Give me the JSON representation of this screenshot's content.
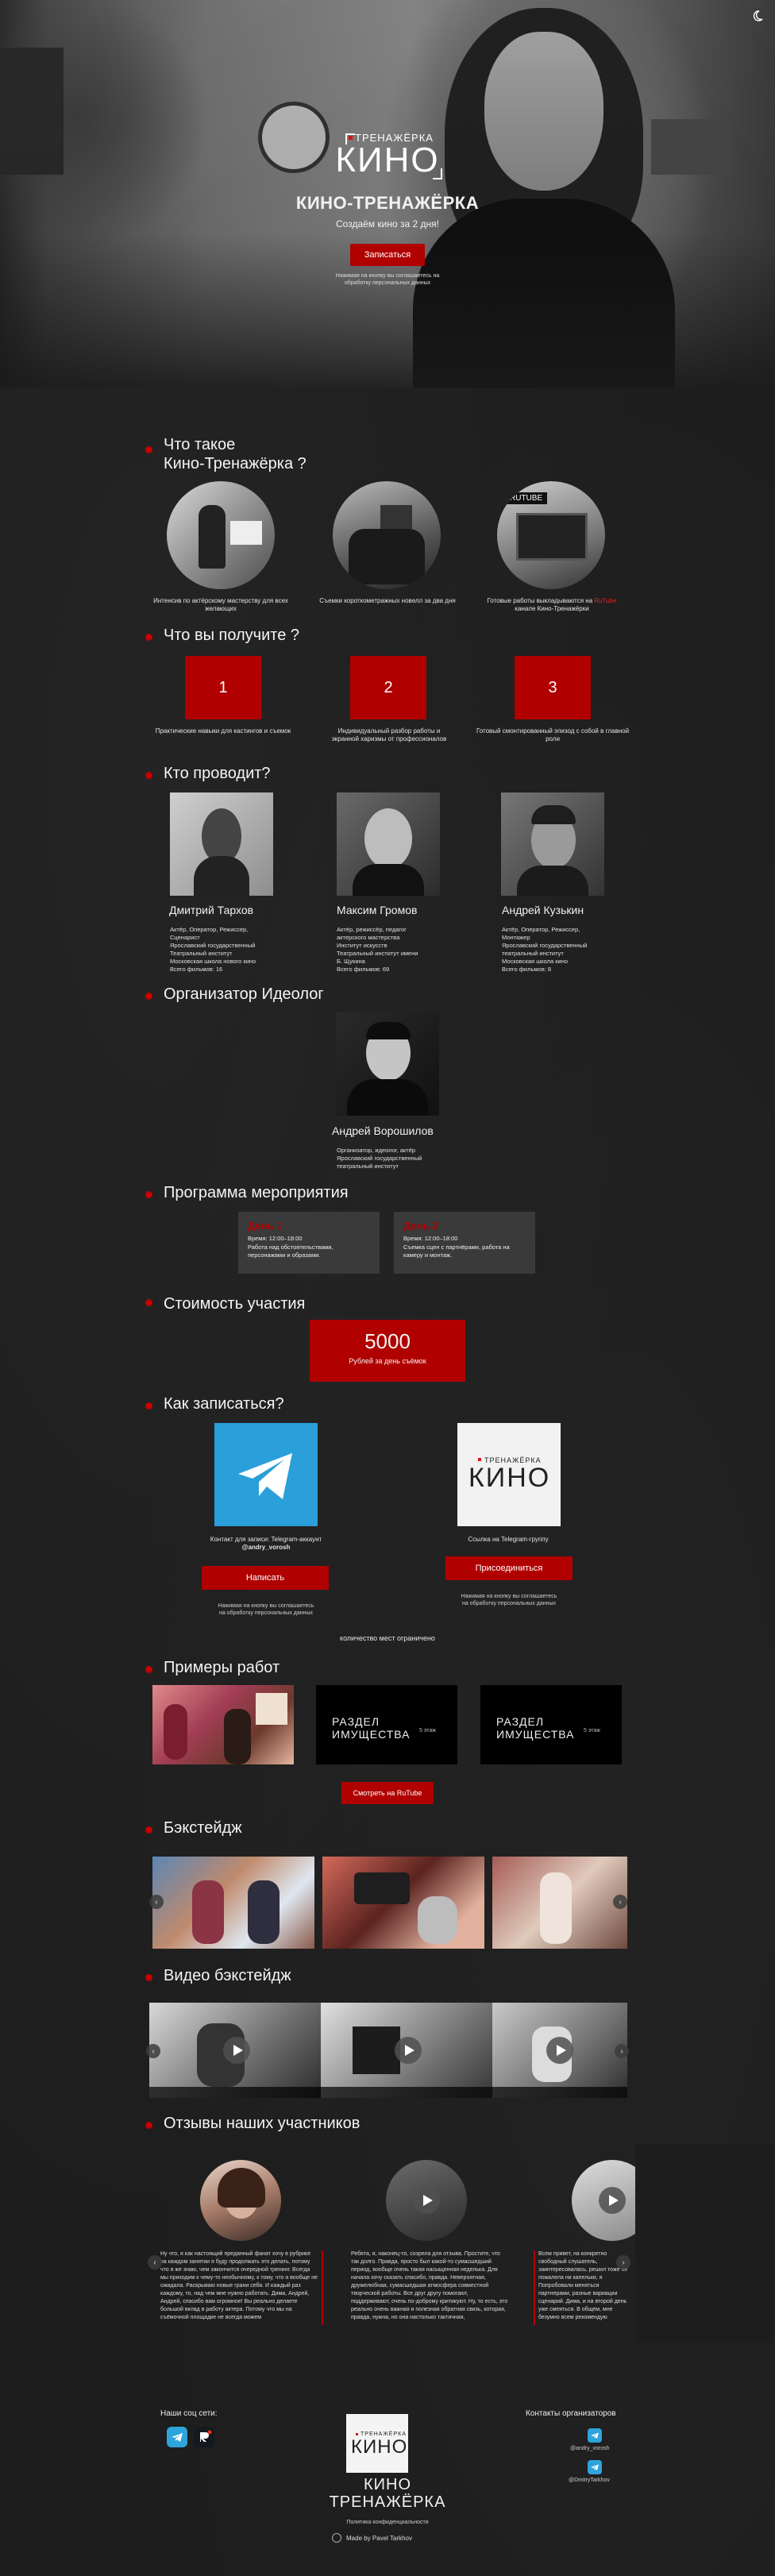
{
  "hero": {
    "logo_top": "ТРЕНАЖЁРКА",
    "logo_main": "КИНО",
    "title": "КИНО-ТРЕНАЖЁРКА",
    "subtitle": "Создаём кино за 2 дня!",
    "cta": "Записаться",
    "note": "Нажимая на кнопку вы соглашаетесь на обработку персональных данных"
  },
  "theme_toggle_icon": "moon-icon",
  "about": {
    "title_line1": "Что такое",
    "title_line2": "Кино-Тренажёрка ?",
    "items": [
      {
        "caption": "Интенсив по актёрскому мастерству для всех желающих"
      },
      {
        "caption": "Съемки короткометражных новелл за два дня"
      },
      {
        "caption_pre": "Готовые работы выкладываются на ",
        "caption_link": "RuTube",
        "caption_post": " канале Кино-Тренажёрки",
        "badge": "RUTUBE"
      }
    ]
  },
  "benefits": {
    "title": "Что вы получите ?",
    "items": [
      {
        "num": "1",
        "caption": "Практические навыки для кастингов и съемок"
      },
      {
        "num": "2",
        "caption": "Индивидуальный разбор работы и экранной харизмы от профессионалов"
      },
      {
        "num": "3",
        "caption": "Готовый смонтированный эпизод с собой в главной роли"
      }
    ]
  },
  "hosts": {
    "title": "Кто проводит?",
    "people": [
      {
        "name": "Дмитрий Тархов",
        "lines": [
          "Актёр, Оператор, Режиссер,",
          "Сценарист",
          "Ярославский государственный",
          "Театральный институт",
          "Московская школа нового кино",
          "Всего фильмов: 16"
        ]
      },
      {
        "name": "Максим Громов",
        "lines": [
          "Актёр, режиссёр, педагог",
          "актерского мастерства",
          "Институт искусств",
          "Театральный институт имени",
          "Б. Щукина",
          "Всего фильмов: 69"
        ]
      },
      {
        "name": "Андрей Кузькин",
        "lines": [
          "Актёр, Оператор, Режиссер,",
          "Монтажер",
          "Ярославский государственный",
          "театральный институт",
          "Московская школа кино",
          "Всего фильмов: 8"
        ]
      }
    ]
  },
  "organizer": {
    "title": "Организатор Идеолог",
    "name": "Андрей Ворошилов",
    "lines": [
      "Организатор, идеолог, актёр",
      "Ярославский государственный",
      "театральный институт"
    ]
  },
  "program": {
    "title": "Программа мероприятия",
    "days": [
      {
        "day": "День 1",
        "time": "Время: 12:00–18:00",
        "text": "Работа над обстоятельствами, персонажами и образами."
      },
      {
        "day": "День 2",
        "time": "Время: 12:00–18:00",
        "text": "Съемка сцен с партнёрами, работа на камеру и монтаж."
      }
    ]
  },
  "price": {
    "title": "Стоимость участия",
    "value": "5000",
    "label": "Рублей за день съёмок"
  },
  "signup": {
    "title": "Как записаться?",
    "left_caption": "Контакт для записи: Telegram-аккаунт",
    "left_handle": "@andry_vorosh",
    "left_button": "Написать",
    "right_caption": "Ссылка на Telegram-группу",
    "right_button": "Присоединиться",
    "note": "Нажимая на кнопку вы соглашаетесь на обработку персональных данных",
    "limited": "количество мест ограничено"
  },
  "works": {
    "title": "Примеры работ",
    "cards": [
      {
        "title": ""
      },
      {
        "title": "РАЗДЕЛ ИМУЩЕСТВА",
        "sub": "5 этаж"
      },
      {
        "title": "РАЗДЕЛ ИМУЩЕСТВА",
        "sub": "5 этаж"
      }
    ],
    "button": "Смотреть на RuTube"
  },
  "backstage": {
    "title": "Бэкстейдж"
  },
  "video_backstage": {
    "title": "Видео бэкстейдж"
  },
  "reviews": {
    "title": "Отзывы наших участников",
    "items": [
      {
        "text": "Ну что, я как настоящий преданный фанат хочу в рубрике на каждом занятии я буду продолжать это делать, потому что я же знаю, чем закончится очередной тренинг. Всегда мы приходим к чему-то необычному, к тому, что я вообще не ожидала. Раскрываю новые грани себя. И каждый раз каждому, то, над чем мне нужно работать. Дима, Андрей, Андрей, спасибо вам огромное! Вы реально делаете большой вклад в работу актера. Потому что мы на съёмочной площадке не всегда можем"
      },
      {
        "text": "Ребята, я, наконец-то, созрела для отзыва. Простите, что так долго. Правда, просто был какой-то сумасшедший период, вообще очень такая насыщенная неделька. Для начала хочу сказать спасибо, правда. Невероятная, дружелюбная, сумасшедшая атмосфера совместной творческой работы. Все друг другу помогают, поддерживают, очень по-доброму критикуют. Ну, то есть, это реально очень важная и полезная обратная связь, которая, правда, нужна, но она настолько тактичная,"
      },
      {
        "text": "Всем привет, на конкретно свободный слушатель, заинтересовалась, решил тоже не пожалела ни капельки, я Попробовали меняться партнерами, разные вариации сценарий. Дима, и на второй день уже смеяться. В общем, мне безумно всем рекомендую"
      }
    ]
  },
  "footer": {
    "social_title": "Наши соц сети:",
    "contacts_title": "Контакты организаторов",
    "contacts": [
      "@andry_vorosh",
      "@DmitryTarkhov"
    ],
    "logo_top": "ТРЕНАЖЁРКА",
    "logo_main": "КИНО",
    "brand_line1": "КИНО",
    "brand_line2": "ТРЕНАЖЁРКА",
    "policy": "Политика конфиденциальности",
    "made_by": "Made by Pavel Tarkhov"
  },
  "colors": {
    "accent": "#b00000",
    "background": "#1d1d1d",
    "text": "#f2f2f2"
  }
}
